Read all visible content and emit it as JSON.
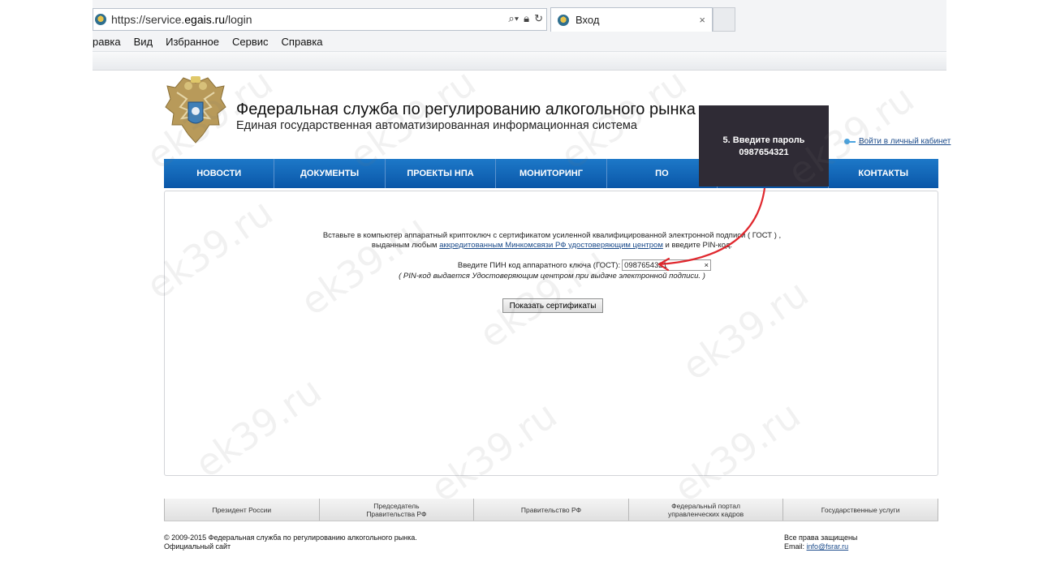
{
  "browser": {
    "url_prefix": "https://service.",
    "url_domain": "egais.ru",
    "url_path": "/login",
    "tab_title": "Вход",
    "tab_close": "×",
    "menu": [
      "равка",
      "Вид",
      "Избранное",
      "Сервис",
      "Справка"
    ]
  },
  "header": {
    "title": "Федеральная служба по регулированию алкогольного рынка РФ",
    "subtitle": "Единая государственная автоматизированная информационная система",
    "cabinet_link": "Войти в личный кабинет"
  },
  "nav": [
    "НОВОСТИ",
    "ДОКУМЕНТЫ",
    "ПРОЕКТЫ НПА",
    "МОНИТОРИНГ",
    "ПО",
    "",
    "КОНТАКТЫ"
  ],
  "tooltip": {
    "line1": "5. Введите пароль",
    "line2": "0987654321"
  },
  "login": {
    "instr_line1": "Вставьте в компьютер аппаратный криптоключ с сертификатом усиленной квалифицированной электронной подписи ( ГОСТ ) ,",
    "instr_line2_pre": "выданным любым ",
    "instr_link": "аккредитованным Минкомсвязи РФ удостоверяющим центром",
    "instr_line2_post": " и введите PIN-код.",
    "pin_label": "Введите ПИН код аппаратного ключа (ГОСТ):",
    "pin_value": "0987654321",
    "pin_clear": "×",
    "pin_hint": "( PIN-код выдается Удостоверяющим центром при выдаче электронной подписи. )",
    "button": "Показать сертификаты"
  },
  "footer": {
    "links": [
      {
        "line1": "Президент России",
        "line2": ""
      },
      {
        "line1": "Председатель",
        "line2": "Правительства РФ"
      },
      {
        "line1": "Правительство РФ",
        "line2": ""
      },
      {
        "line1": "Федеральный портал",
        "line2": "управленческих кадров"
      },
      {
        "line1": "Государственные услуги",
        "line2": ""
      }
    ],
    "copyright_line1": "© 2009-2015 Федеральная служба по регулированию алкогольного рынка.",
    "copyright_line2": "Официальный сайт",
    "rights_line1": "Все права защищены",
    "rights_email_label": "Email: ",
    "rights_email": "info@fsrar.ru"
  },
  "watermark": "ek39.ru",
  "colors": {
    "nav_blue": "#0a57a8",
    "tooltip_bg": "#2f2b35",
    "arrow_red": "#e0282e",
    "link_blue": "#1a4a8a"
  }
}
